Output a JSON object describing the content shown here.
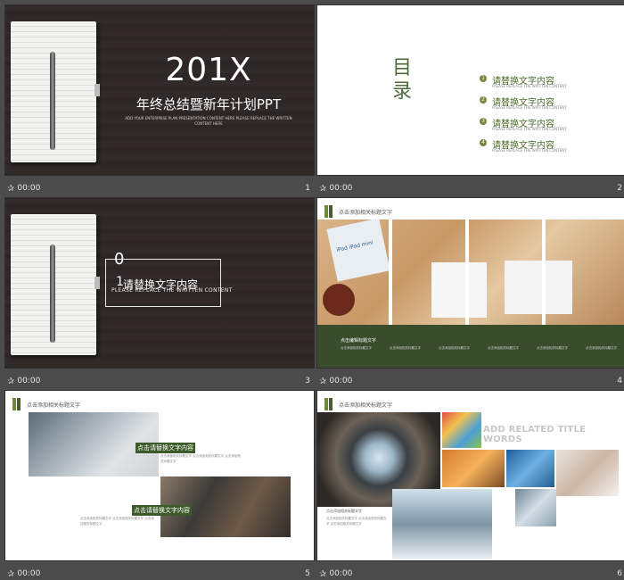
{
  "slides": [
    {
      "number": "1",
      "time": "00:00",
      "title": "201X",
      "subtitle": "年终总结暨新年计划PPT",
      "small_text": "ADD YOUR ENTERPRISE PLAN PRESENTATION CONTENT HERE PLEASE REPLACE THE WRITTEN CONTENT HERE"
    },
    {
      "number": "2",
      "time": "00:00",
      "heading": "目录",
      "items": [
        {
          "index": "1",
          "label": "请替换文字内容",
          "desc": "PLEASE REPLACE THE WRITTEN CONTENT"
        },
        {
          "index": "2",
          "label": "请替换文字内容",
          "desc": "PLEASE REPLACE THE WRITTEN CONTENT"
        },
        {
          "index": "3",
          "label": "请替换文字内容",
          "desc": "PLEASE REPLACE THE WRITTEN CONTENT"
        },
        {
          "index": "4",
          "label": "请替换文字内容",
          "desc": "PLEASE REPLACE THE WRITTEN CONTENT"
        }
      ]
    },
    {
      "number": "3",
      "time": "00:00",
      "section_number": "0",
      "section_digit": "1",
      "section_title": "请替换文字内容",
      "section_sub": "PLEASE REPLACE THE WRITTEN CONTENT"
    },
    {
      "number": "4",
      "time": "00:00",
      "header": "点击添加相关标题文字",
      "photo_label": "iPod iPod mini",
      "band_heading": "点击编辑标题文字",
      "band_row": [
        "点击添加相关标题文字",
        "点击添加相关标题文字",
        "点击添加相关标题文字",
        "点击添加相关标题文字",
        "点击添加相关标题文字",
        "点击添加相关标题文字"
      ]
    },
    {
      "number": "5",
      "time": "00:00",
      "header": "点击添加相关标题文字",
      "label_a": "点击请替换文字内容",
      "label_b": "点击请替换文字内容",
      "body_a": "点击添加相关标题文字 点击添加相关标题文字 点击添加相关标题文字",
      "body_b": "点击添加相关标题文字 点击添加相关标题文字 点击添加相关标题文字"
    },
    {
      "number": "6",
      "time": "00:00",
      "header": "点击添加相关标题文字",
      "title_words": "ADD RELATED  TITLE WORDS",
      "side_label": "点击添加相关标题文字",
      "side_text": "点击添加相关标题文字 点击添加相关标题文字 点击添加相关标题文字"
    }
  ]
}
